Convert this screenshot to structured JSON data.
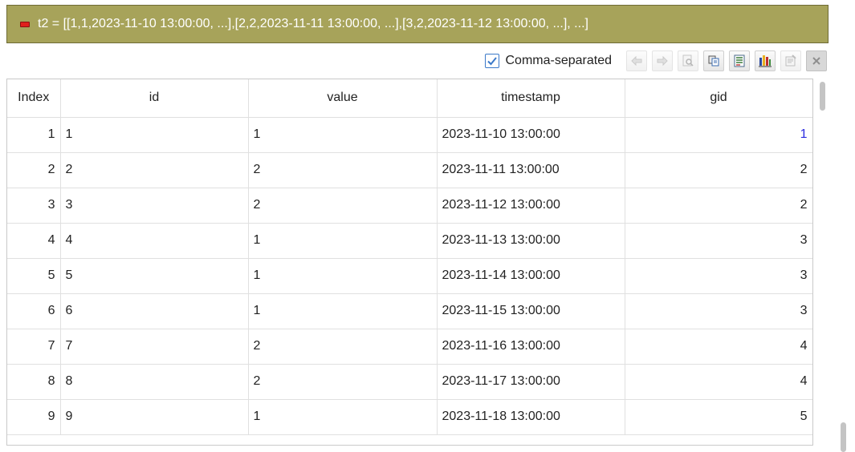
{
  "header": {
    "expression": "t2 = [[1,1,2023-11-10 13:00:00, ...],[2,2,2023-11-11 13:00:00, ...],[3,2,2023-11-12 13:00:00, ...], ...]"
  },
  "toolbar": {
    "comma_separated_label": "Comma-separated",
    "comma_separated_checked": true,
    "buttons": [
      "back-icon",
      "forward-icon",
      "preview-icon",
      "copy-icon",
      "list-icon",
      "chart-icon",
      "properties-icon",
      "close-icon"
    ]
  },
  "table": {
    "columns": [
      "Index",
      "id",
      "value",
      "timestamp",
      "gid"
    ],
    "rows": [
      {
        "index": "1",
        "id": "1",
        "value": "1",
        "timestamp": "2023-11-10 13:00:00",
        "gid": "1"
      },
      {
        "index": "2",
        "id": "2",
        "value": "2",
        "timestamp": "2023-11-11 13:00:00",
        "gid": "2"
      },
      {
        "index": "3",
        "id": "3",
        "value": "2",
        "timestamp": "2023-11-12 13:00:00",
        "gid": "2"
      },
      {
        "index": "4",
        "id": "4",
        "value": "1",
        "timestamp": "2023-11-13 13:00:00",
        "gid": "3"
      },
      {
        "index": "5",
        "id": "5",
        "value": "1",
        "timestamp": "2023-11-14 13:00:00",
        "gid": "3"
      },
      {
        "index": "6",
        "id": "6",
        "value": "1",
        "timestamp": "2023-11-15 13:00:00",
        "gid": "3"
      },
      {
        "index": "7",
        "id": "7",
        "value": "2",
        "timestamp": "2023-11-16 13:00:00",
        "gid": "4"
      },
      {
        "index": "8",
        "id": "8",
        "value": "2",
        "timestamp": "2023-11-17 13:00:00",
        "gid": "4"
      },
      {
        "index": "9",
        "id": "9",
        "value": "1",
        "timestamp": "2023-11-18 13:00:00",
        "gid": "5"
      }
    ]
  },
  "colors": {
    "header_bg": "#a7a35a",
    "selected_text": "#2c2ce0",
    "checkbox_accent": "#3b79c9"
  }
}
